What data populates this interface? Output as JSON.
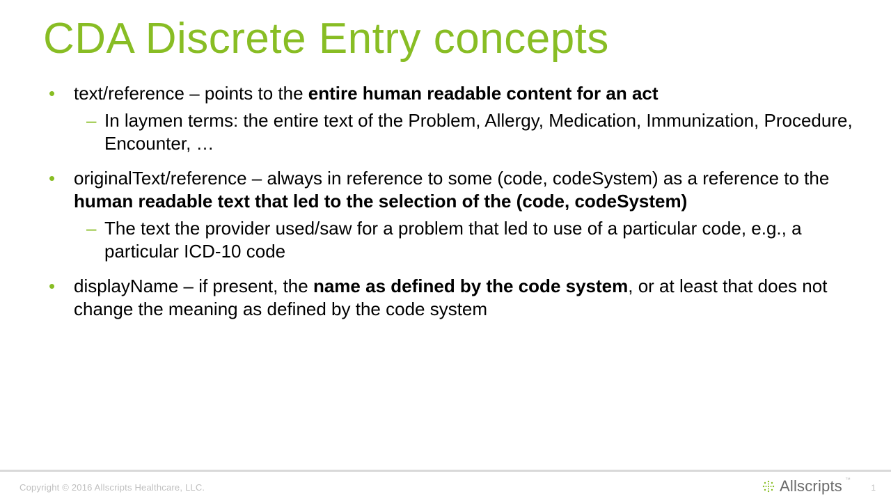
{
  "colors": {
    "accent": "#88bd24",
    "footer_text": "#bfbfbf",
    "brand_text": "#6a6a6a"
  },
  "title": "CDA Discrete Entry concepts",
  "bullets": [
    {
      "pre": "text/reference – points to the ",
      "bold": "entire human readable content for an act",
      "post": "",
      "sub": [
        "In laymen terms: the entire text of the Problem, Allergy, Medication, Immunization, Procedure, Encounter, …"
      ]
    },
    {
      "pre": "originalText/reference – always in reference to some (code, codeSystem) as a reference to the ",
      "bold": "human readable text that led to the selection of the (code, codeSystem)",
      "post": "",
      "sub": [
        "The text the provider used/saw for a problem that led to use of a particular code, e.g., a particular ICD-10 code"
      ]
    },
    {
      "pre": "displayName – if present, the ",
      "bold": "name as defined by the code system",
      "post": ", or at least that does not change the meaning as defined by the code system",
      "sub": []
    }
  ],
  "footer": {
    "copyright": "Copyright © 2016 Allscripts Healthcare, LLC.",
    "brand": "Allscripts",
    "tm": "™",
    "page": "1"
  }
}
